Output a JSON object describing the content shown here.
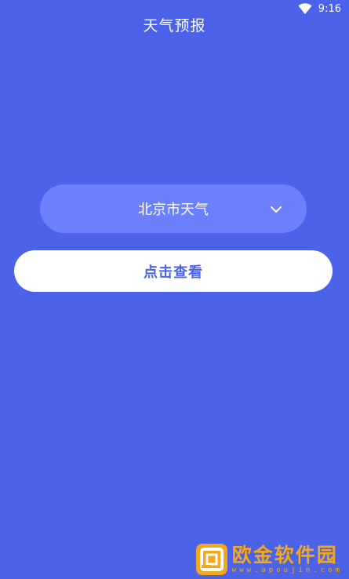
{
  "status_bar": {
    "time": "9:16",
    "wifi_icon": "wifi-icon"
  },
  "header": {
    "title": "天气预报"
  },
  "city_selector": {
    "selected_value": "北京市天气",
    "icon": "chevron-down-icon"
  },
  "actions": {
    "check_label": "点击查看"
  },
  "watermark": {
    "name": "欧金软件园",
    "url": "www.apoujin.com",
    "logo_icon": "watermark-logo"
  },
  "colors": {
    "background": "#4a63e8",
    "selector_bg": "#6c80fb",
    "button_bg": "#ffffff",
    "button_text": "#4a63e8",
    "watermark": "#f2a818"
  }
}
